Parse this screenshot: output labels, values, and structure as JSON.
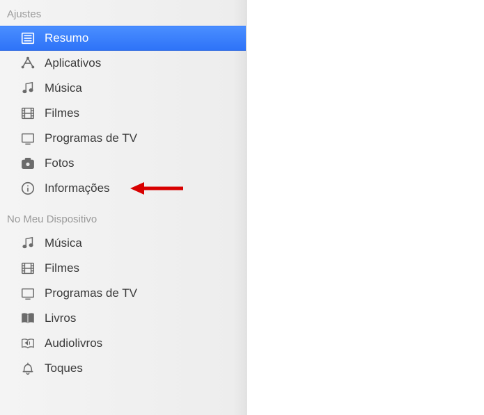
{
  "sections": {
    "ajustes": {
      "header": "Ajustes",
      "items": [
        {
          "label": "Resumo",
          "icon": "summary",
          "selected": true
        },
        {
          "label": "Aplicativos",
          "icon": "apps",
          "selected": false
        },
        {
          "label": "Música",
          "icon": "music",
          "selected": false
        },
        {
          "label": "Filmes",
          "icon": "film",
          "selected": false
        },
        {
          "label": "Programas de TV",
          "icon": "tv",
          "selected": false
        },
        {
          "label": "Fotos",
          "icon": "camera",
          "selected": false
        },
        {
          "label": "Informações",
          "icon": "info",
          "selected": false,
          "annotated": true
        }
      ]
    },
    "device": {
      "header": "No Meu Dispositivo",
      "items": [
        {
          "label": "Música",
          "icon": "music",
          "selected": false
        },
        {
          "label": "Filmes",
          "icon": "film",
          "selected": false
        },
        {
          "label": "Programas de TV",
          "icon": "tv",
          "selected": false
        },
        {
          "label": "Livros",
          "icon": "books",
          "selected": false
        },
        {
          "label": "Audiolivros",
          "icon": "audiobooks",
          "selected": false
        },
        {
          "label": "Toques",
          "icon": "bell",
          "selected": false
        }
      ]
    }
  },
  "annotation": {
    "color": "#d80000"
  }
}
